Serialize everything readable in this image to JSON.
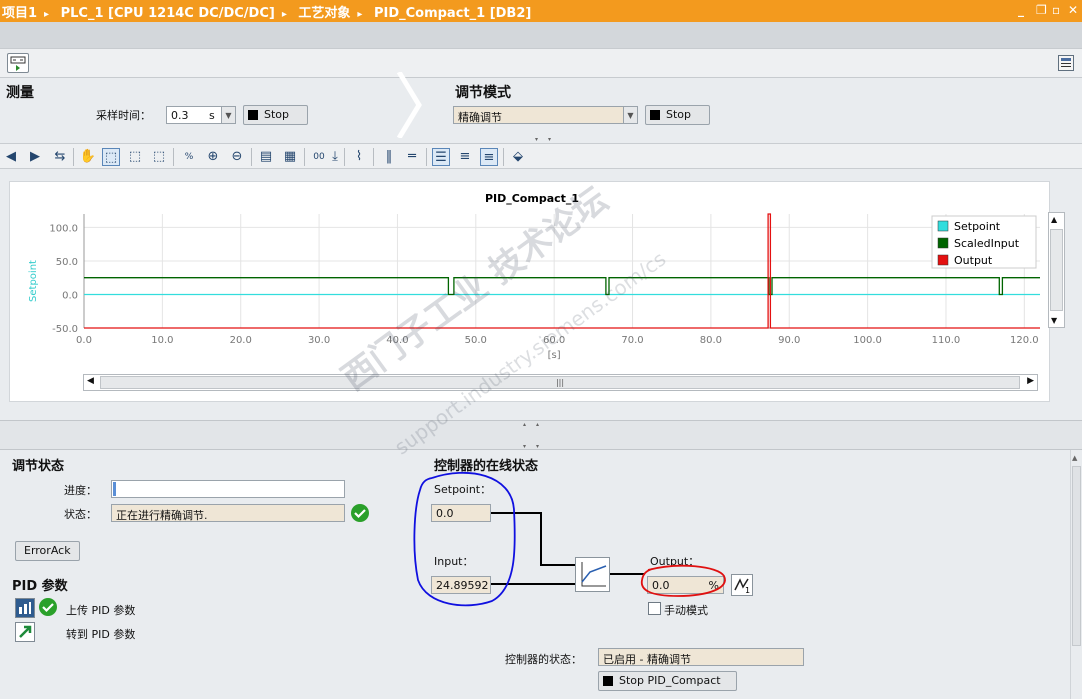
{
  "titlebar": {
    "crumbs": [
      "项目1",
      "PLC_1 [CPU 1214C DC/DC/DC]",
      "工艺对象",
      "PID_Compact_1 [DB2]"
    ],
    "window_controls": [
      "_",
      "❐",
      "▫",
      "✕"
    ]
  },
  "measurement": {
    "heading": "测量",
    "sample_time_label": "采样时间：",
    "sample_time_value": "0.3",
    "sample_time_unit": "s",
    "stop_label": "Stop"
  },
  "tuning_mode": {
    "heading": "调节模式",
    "mode_value": "精确调节",
    "stop_label": "Stop"
  },
  "chart": {
    "title": "PID_Compact_1",
    "ylabel": "Setpoint",
    "xlabel": "[s]",
    "legend": [
      "Setpoint",
      "ScaledInput",
      "Output"
    ],
    "colors": {
      "Setpoint": "#33dddd",
      "ScaledInput": "#006400",
      "Output": "#e41010"
    }
  },
  "chart_data": {
    "type": "line",
    "title": "PID_Compact_1",
    "xlabel": "[s]",
    "ylabel": "Setpoint",
    "xlim": [
      0,
      122
    ],
    "ylim": [
      -50,
      120
    ],
    "xticks": [
      "0.0",
      "10.0",
      "20.0",
      "30.0",
      "40.0",
      "50.0",
      "60.0",
      "70.0",
      "80.0",
      "90.0",
      "100.0",
      "110.0",
      "120.0"
    ],
    "yticks": [
      "100.0",
      "50.0",
      "0.0",
      "-50.0"
    ],
    "series": [
      {
        "name": "Setpoint",
        "color": "#33dddd",
        "x": [
          0,
          122
        ],
        "y": [
          0,
          0
        ]
      },
      {
        "name": "ScaledInput",
        "color": "#006400",
        "x": [
          0,
          46.5,
          46.5,
          47.2,
          47.2,
          66.6,
          66.6,
          67.0,
          67.0,
          87.4,
          87.4,
          87.8,
          87.8,
          116.8,
          116.8,
          117.2,
          117.2,
          122
        ],
        "y": [
          25,
          25,
          0,
          0,
          25,
          25,
          0,
          0,
          25,
          25,
          0,
          0,
          25,
          25,
          0,
          0,
          25,
          25
        ]
      },
      {
        "name": "Output",
        "color": "#e41010",
        "x": [
          0,
          87.3,
          87.3,
          87.6,
          87.6,
          122
        ],
        "y": [
          -50,
          -50,
          120,
          120,
          -50,
          -50
        ]
      }
    ],
    "grid": true,
    "legend_position": "top-right"
  },
  "tuning_status": {
    "heading": "调节状态",
    "progress_label": "进度：",
    "progress": 0.01,
    "status_label": "状态：",
    "status_value": "正在进行精确调节.",
    "erroack_label": "ErrorAck"
  },
  "pid_params": {
    "heading": "PID 参数",
    "upload_label": "上传 PID 参数",
    "goto_label": "转到 PID 参数"
  },
  "online_status": {
    "heading": "控制器的在线状态",
    "setpoint_label": "Setpoint：",
    "setpoint_value": "0.0",
    "input_label": "Input：",
    "input_value": "24.89592",
    "output_label": "Output：",
    "output_value": "0.0",
    "output_unit": "%",
    "manual_label": "手动模式",
    "controller_state_label": "控制器的状态：",
    "controller_state_value": "已启用 - 精确调节",
    "stop_button_label": "Stop PID_Compact"
  },
  "watermark": {
    "line1": "西门子工业 技术论坛",
    "line2": "support.industry.siemens.com/cs"
  }
}
